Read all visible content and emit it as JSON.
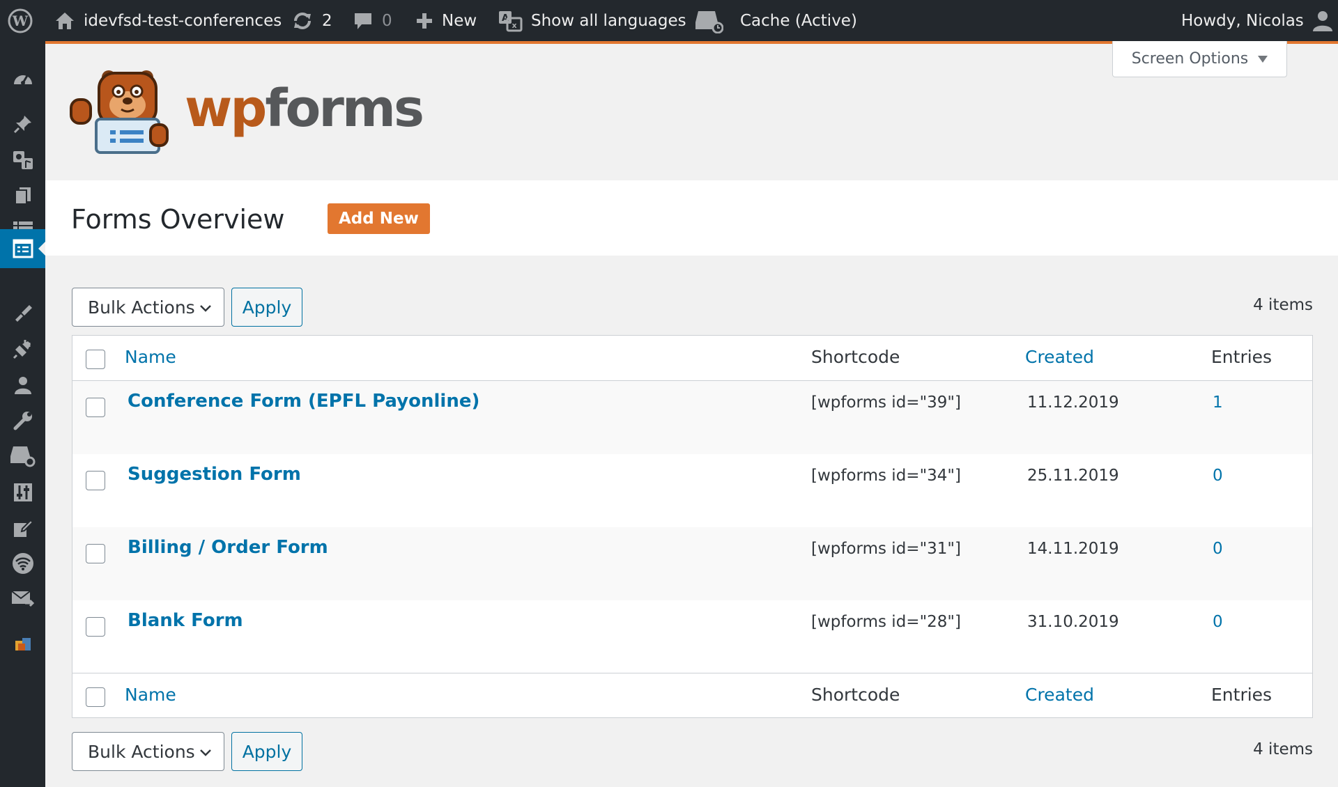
{
  "adminbar": {
    "site_name": "idevfsd-test-conferences",
    "updates_count": "2",
    "comments_count": "0",
    "new_label": "New",
    "languages_label": "Show all languages",
    "cache_label": "Cache (Active)",
    "howdy": "Howdy, Nicolas"
  },
  "admin_menu_icons": [
    "dashboard-icon",
    "posts-pin-icon",
    "media-icon",
    "pages-icon",
    "list-icon",
    "wpforms-icon",
    "appearance-brush-icon",
    "plugins-icon",
    "users-icon",
    "tools-wrench-icon",
    "cache-icon",
    "settings-sliders-icon",
    "edit-icon",
    "wifi-icon",
    "mail-icon",
    "plugin-logo-icon"
  ],
  "screen_options": {
    "label": "Screen Options"
  },
  "logo": {
    "wp": "wp",
    "forms": "forms"
  },
  "page": {
    "title": "Forms Overview",
    "add_new": "Add New"
  },
  "tablenav": {
    "bulk_actions": "Bulk Actions",
    "apply": "Apply",
    "items_count": "4 items"
  },
  "table": {
    "columns": {
      "name": "Name",
      "shortcode": "Shortcode",
      "created": "Created",
      "entries": "Entries"
    },
    "rows": [
      {
        "name": "Conference Form (EPFL Payonline)",
        "shortcode": "[wpforms id=\"39\"]",
        "created": "11.12.2019",
        "entries": "1"
      },
      {
        "name": "Suggestion Form",
        "shortcode": "[wpforms id=\"34\"]",
        "created": "25.11.2019",
        "entries": "0"
      },
      {
        "name": "Billing / Order Form",
        "shortcode": "[wpforms id=\"31\"]",
        "created": "14.11.2019",
        "entries": "0"
      },
      {
        "name": "Blank Form",
        "shortcode": "[wpforms id=\"28\"]",
        "created": "31.10.2019",
        "entries": "0"
      }
    ]
  },
  "colors": {
    "accent": "#e27730",
    "link": "#0073aa",
    "adminbar": "#23282d",
    "menu_current": "#0073aa"
  }
}
